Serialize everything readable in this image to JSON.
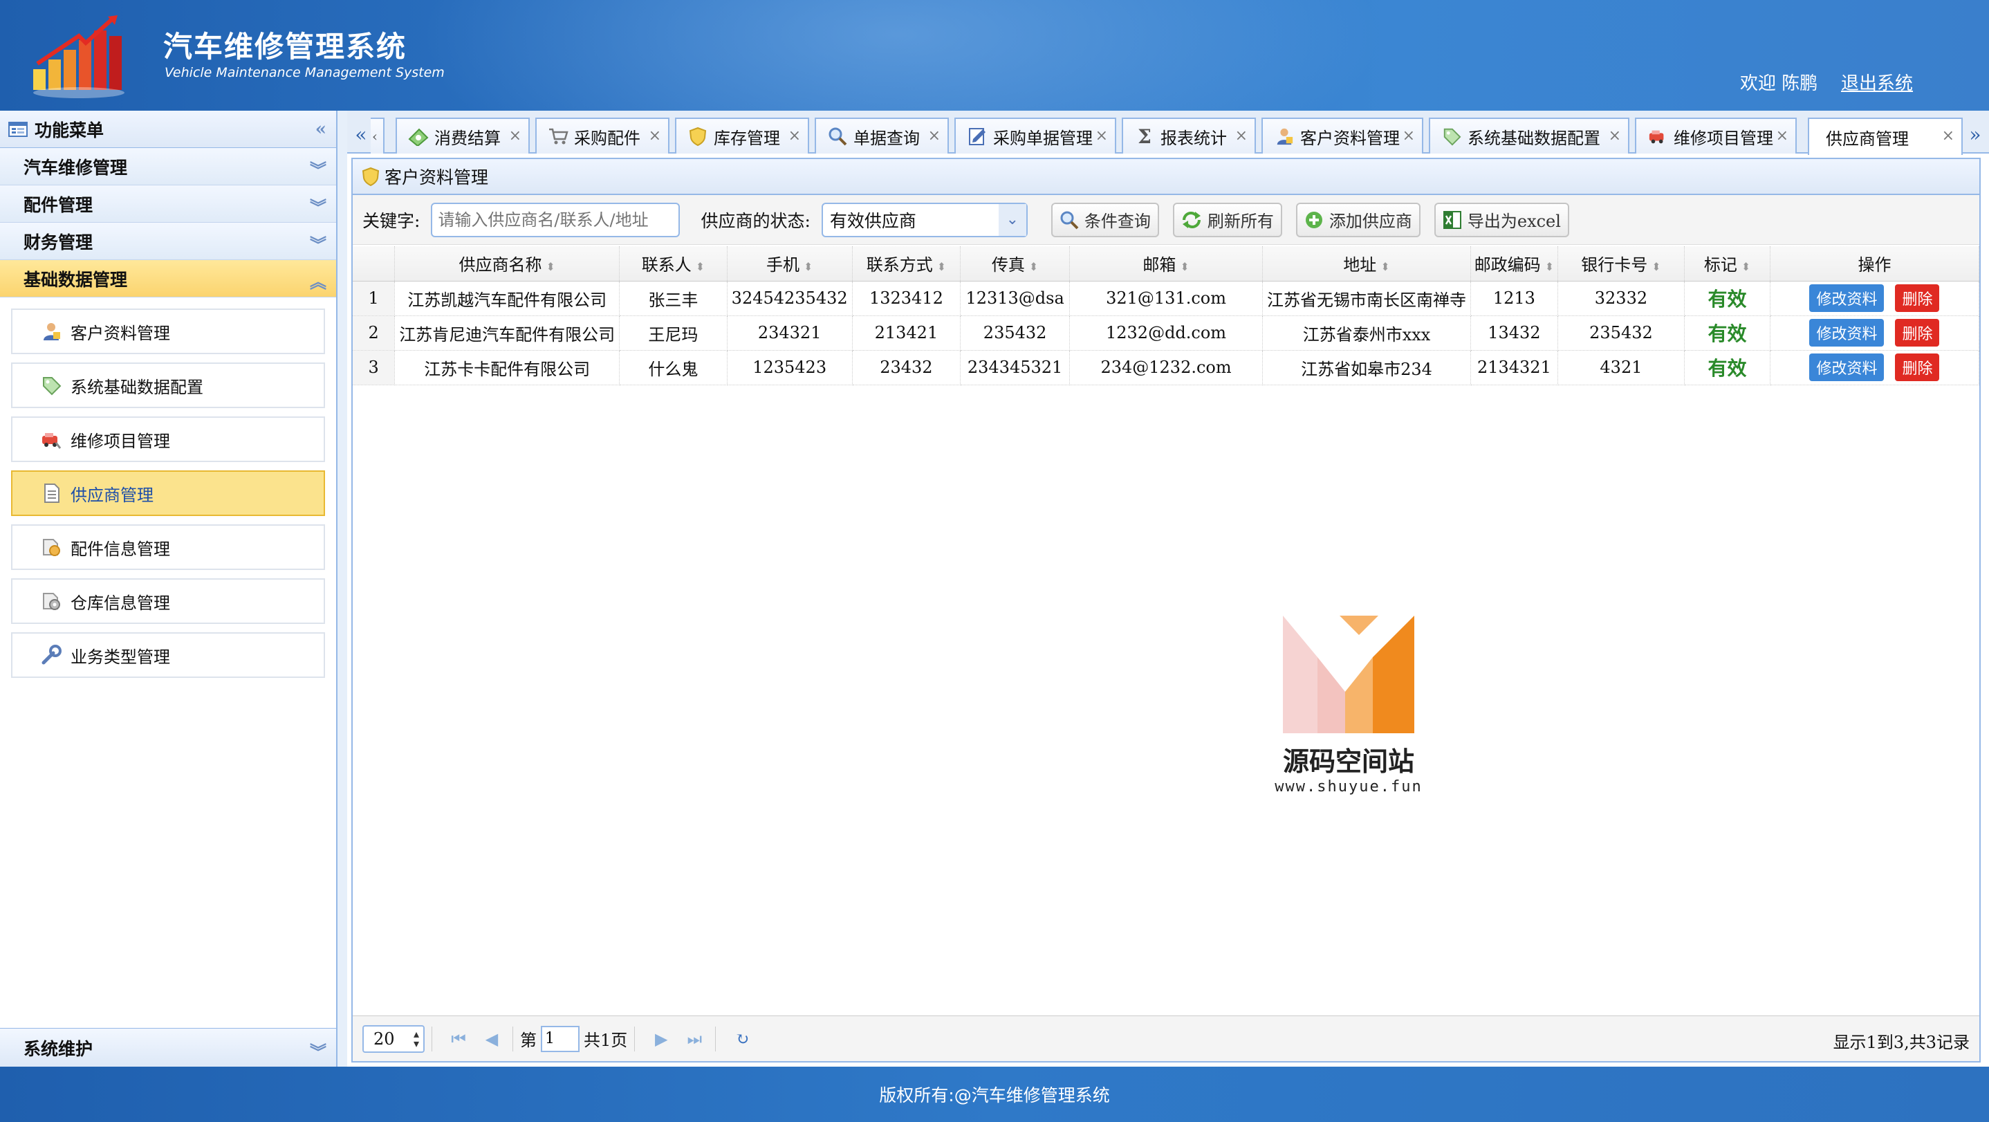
{
  "header": {
    "title_cn": "汽车维修管理系统",
    "title_en": "Vehicle Maintenance Management System",
    "welcome": "欢迎 陈鹏",
    "logout": "退出系统"
  },
  "sidebar": {
    "title": "功能菜单",
    "groups": [
      {
        "label": "汽车维修管理"
      },
      {
        "label": "配件管理"
      },
      {
        "label": "财务管理"
      },
      {
        "label": "基础数据管理"
      }
    ],
    "items": [
      {
        "label": "客户资料管理",
        "icon": "user-icon"
      },
      {
        "label": "系统基础数据配置",
        "icon": "tag-icon"
      },
      {
        "label": "维修项目管理",
        "icon": "car-icon"
      },
      {
        "label": "供应商管理",
        "icon": "document-icon"
      },
      {
        "label": "配件信息管理",
        "icon": "parts-icon"
      },
      {
        "label": "仓库信息管理",
        "icon": "warehouse-icon"
      },
      {
        "label": "业务类型管理",
        "icon": "wrench-icon"
      }
    ],
    "bottom": "系统维护"
  },
  "tabs": [
    {
      "label": "消费结算"
    },
    {
      "label": "采购配件"
    },
    {
      "label": "库存管理"
    },
    {
      "label": "单据查询"
    },
    {
      "label": "采购单据管理"
    },
    {
      "label": "报表统计"
    },
    {
      "label": "客户资料管理"
    },
    {
      "label": "系统基础数据配置"
    },
    {
      "label": "维修项目管理"
    },
    {
      "label": "供应商管理"
    }
  ],
  "content": {
    "title": "客户资料管理",
    "toolbar": {
      "keyword_label": "关键字:",
      "keyword_placeholder": "请输入供应商名/联系人/地址",
      "status_label": "供应商的状态:",
      "status_value": "有效供应商",
      "search": "条件查询",
      "refresh": "刷新所有",
      "add": "添加供应商",
      "export": "导出为excel"
    },
    "columns": [
      "供应商名称",
      "联系人",
      "手机",
      "联系方式",
      "传真",
      "邮箱",
      "地址",
      "邮政编码",
      "银行卡号",
      "标记",
      "操作"
    ],
    "rows": [
      {
        "n": "1",
        "name": "江苏凯越汽车配件有限公司",
        "contact": "张三丰",
        "mobile": "32454235432",
        "phone": "1323412",
        "fax": "12313@dsa",
        "email": "321@131.com",
        "address": "江苏省无锡市南长区南禅寺",
        "zip": "1213",
        "card": "32332",
        "mark": "有效"
      },
      {
        "n": "2",
        "name": "江苏肯尼迪汽车配件有限公司",
        "contact": "王尼玛",
        "mobile": "234321",
        "phone": "213421",
        "fax": "235432",
        "email": "1232@dd.com",
        "address": "江苏省泰州市xxx",
        "zip": "13432",
        "card": "235432",
        "mark": "有效"
      },
      {
        "n": "3",
        "name": "江苏卡卡配件有限公司",
        "contact": "什么鬼",
        "mobile": "1235423",
        "phone": "23432",
        "fax": "234345321",
        "email": "234@1232.com",
        "address": "江苏省如皋市234",
        "zip": "2134321",
        "card": "4321",
        "mark": "有效"
      }
    ],
    "edit_label": "修改资料",
    "delete_label": "删除",
    "pager": {
      "page_size": "20",
      "page_prefix": "第",
      "page_value": "1",
      "page_total": "共1页",
      "info": "显示1到3,共3记录"
    }
  },
  "watermark": {
    "name": "源码空间站",
    "url": "www.shuyue.fun"
  },
  "footer": {
    "copyright": "版权所有:@汽车维修管理系统"
  },
  "colors": {
    "header_blue": "#2d74c4",
    "border_blue": "#95b8e7",
    "active_yellow": "#fbe38d",
    "valid_green": "#2a8a2a",
    "edit_blue": "#3a86d8",
    "delete_red": "#e02a22"
  }
}
